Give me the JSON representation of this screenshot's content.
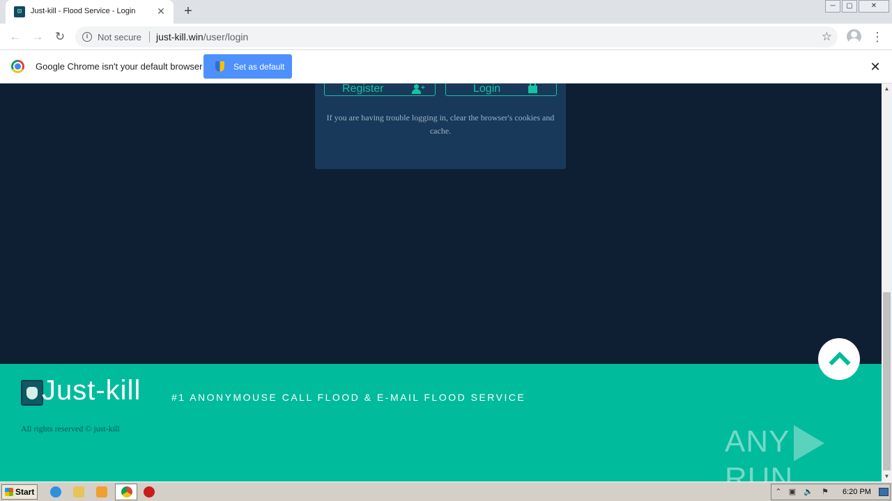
{
  "browser": {
    "tab": {
      "title": "Just-kill - Flood Service - Login",
      "favicon": "shield-mask-icon"
    },
    "new_tab_label": "+",
    "window_controls": {
      "minimize": "─",
      "maximize": "▢",
      "close": "✕"
    },
    "toolbar": {
      "back_glyph": "←",
      "forward_glyph": "→",
      "reload_glyph": "↻",
      "security_label": "Not secure",
      "url_host": "just-kill.win",
      "url_path": "/user/login",
      "bookmark_glyph": "☆",
      "menu_glyph": "⋮"
    },
    "infobar": {
      "message": "Google Chrome isn't your default browser",
      "button_label": "Set as default",
      "close_glyph": "✕"
    }
  },
  "page": {
    "login_card": {
      "register_label": "Register",
      "login_label": "Login",
      "note": "If you are having trouble logging in, clear the browser's cookies and cache."
    },
    "footer": {
      "brand": "Just-kill",
      "tagline": "#1 ANONYMOUSE CALL FLOOD & E-MAIL FLOOD SERVICE",
      "copyright": "All rights reserved © just-kill",
      "accent_color": "#00bb9c"
    },
    "watermark": {
      "left": "ANY",
      "right": "RUN"
    }
  },
  "scrollbar": {
    "up_glyph": "▲",
    "down_glyph": "▼"
  },
  "taskbar": {
    "start_label": "Start",
    "tray_glyphs": [
      "⌃",
      "▣",
      "🔈",
      "⚑"
    ],
    "clock": "6:20 PM"
  }
}
